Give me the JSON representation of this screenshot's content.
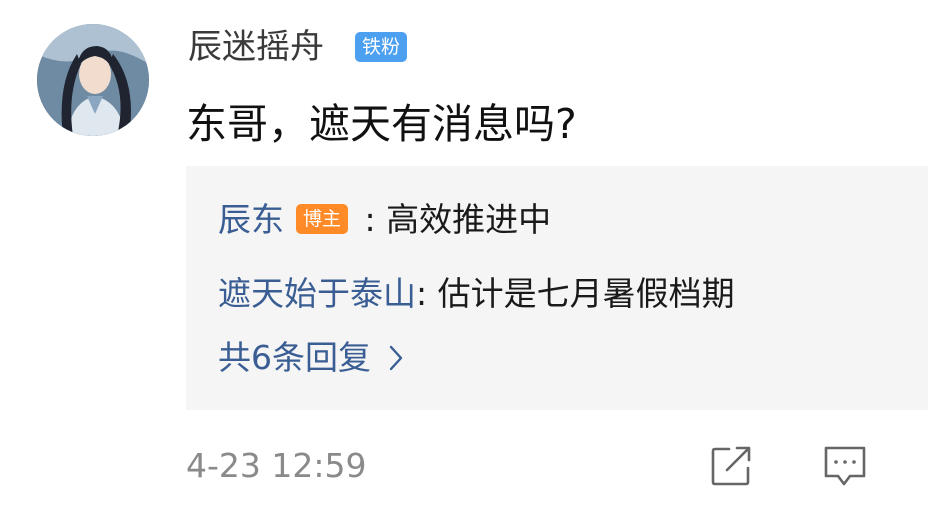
{
  "comment": {
    "username": "辰迷摇舟",
    "fan_badge": "铁粉",
    "text": "东哥，遮天有消息吗?",
    "timestamp": "4-23 12:59"
  },
  "replies": [
    {
      "name": "辰东",
      "badge": "博主",
      "separator": " : ",
      "text": "高效推进中"
    },
    {
      "name": "遮天始于泰山",
      "separator": ": ",
      "text": "估计是七月暑假档期"
    }
  ],
  "more_replies_label": "共6条回复",
  "icons": {
    "share": "share-icon",
    "comment": "comment-icon",
    "more": "chevron-right-icon"
  },
  "colors": {
    "link_blue": "#3a5e93",
    "fan_badge": "#4d9ff0",
    "blogger_badge": "#ff8a28",
    "reply_bg": "#f5f5f5",
    "muted": "#8a8a8a"
  }
}
